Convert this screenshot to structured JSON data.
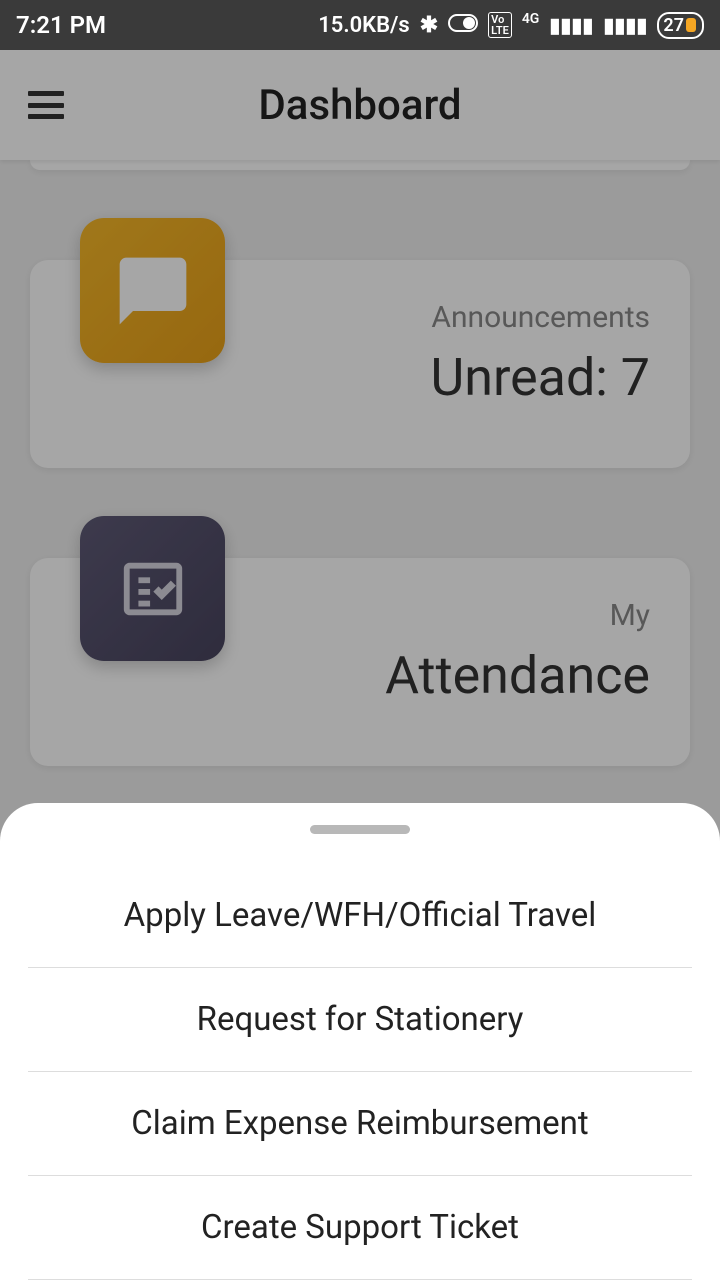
{
  "statusBar": {
    "time": "7:21 PM",
    "speed": "15.0KB/s",
    "network": "4G",
    "battery": "27"
  },
  "header": {
    "title": "Dashboard"
  },
  "cards": {
    "announcements": {
      "subtitle": "Announcements",
      "title": "Unread: 7"
    },
    "attendance": {
      "subtitle": "My",
      "title": "Attendance"
    }
  },
  "sheet": {
    "items": [
      "Apply Leave/WFH/Official Travel",
      "Request for Stationery",
      "Claim Expense Reimbursement",
      "Create Support Ticket"
    ]
  }
}
